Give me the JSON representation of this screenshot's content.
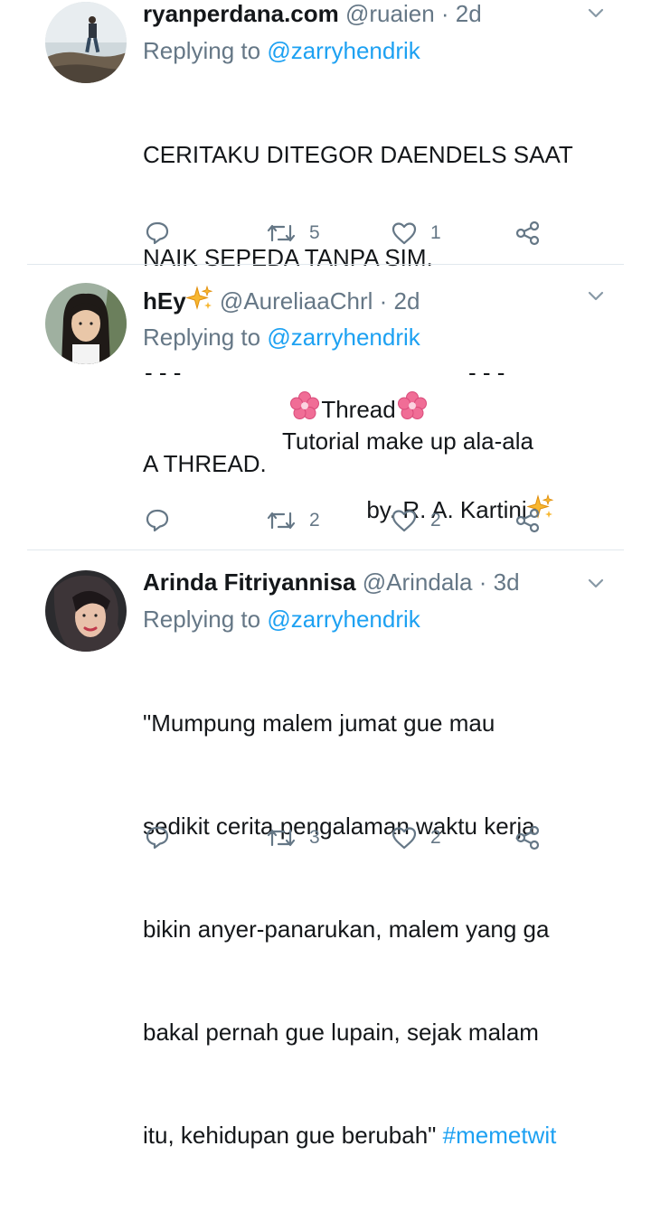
{
  "colors": {
    "link": "#1da1f2",
    "muted": "#657786",
    "text": "#14171a",
    "divider": "#e1e8ed"
  },
  "tweets": [
    {
      "name": "ryanperdana.com",
      "handle": "@ruaien",
      "separator": "·",
      "time": "2d",
      "replying_prefix": "Replying to",
      "replying_to": "@zarryhendrik",
      "lines": [
        "CERITAKU DITEGOR DAENDELS SAAT",
        "NAIK SEPEDA TANPA SIM.",
        "A THREAD."
      ],
      "retweets": "5",
      "likes": "1"
    },
    {
      "name": "hEy",
      "name_emoji": "sparkles",
      "handle": "@AureliaaChrl",
      "separator": "·",
      "time": "2d",
      "replying_prefix": "Replying to",
      "replying_to": "@zarryhendrik",
      "dashes_left": "- - -",
      "thread_word": "Thread",
      "dashes_right": "- - -",
      "line2": "Tutorial make up ala-ala",
      "line3": "by. R. A. Kartini",
      "retweets": "2",
      "likes": "2"
    },
    {
      "name": "Arinda Fitriyannisa",
      "handle": "@Arindala",
      "separator": "·",
      "time": "3d",
      "replying_prefix": "Replying to",
      "replying_to": "@zarryhendrik",
      "lines": [
        "\"Mumpung malem jumat gue mau",
        "sedikit cerita pengalaman waktu kerja",
        "bikin anyer-panarukan, malem yang ga",
        "bakal pernah gue lupain, sejak malam",
        "itu, kehidupan gue berubah\""
      ],
      "hashtag": "#memetwit",
      "retweets": "3",
      "likes": "2"
    }
  ],
  "icons": {
    "reply": "reply-icon",
    "retweet": "retweet-icon",
    "like": "heart-icon",
    "share": "share-icon",
    "menu": "chevron-down-icon",
    "emoji": "sparkles-icon",
    "flower": "cherry-blossom-icon"
  }
}
